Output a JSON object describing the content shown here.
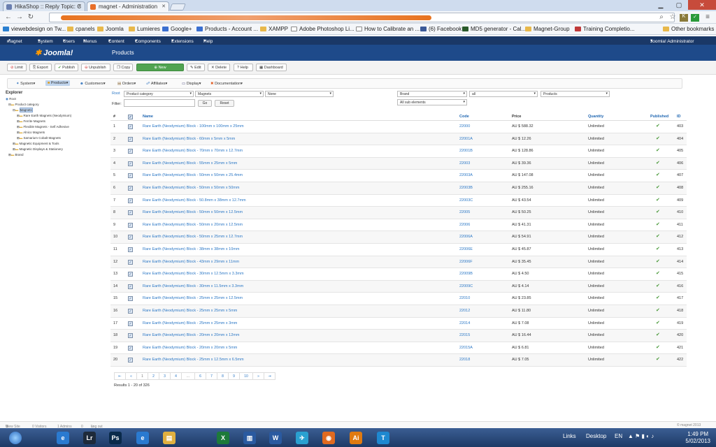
{
  "browser": {
    "tabs": [
      {
        "label": "HikaShop :: Reply Topic: C",
        "color": "#6a7fb0"
      },
      {
        "label": "magnet - Administration",
        "color": "#e86f2a"
      }
    ],
    "bookmarks": [
      "viewebdesign on Tw...",
      "cpanels",
      "Joomla",
      "Lumieres",
      "Google+",
      "Products - Account ...",
      "XAMPP",
      "Adobe Photoshop Li...",
      "How to Calibrate an ...",
      "(6) Facebook",
      "MD5 generator - Cal...",
      "Magnet-Group",
      "Training Completio..."
    ],
    "other_bookmarks": "Other bookmarks"
  },
  "joomla": {
    "site": "magnet",
    "menu": [
      "System",
      "Users",
      "Menus",
      "Content",
      "Components",
      "Extensions",
      "Help"
    ],
    "user": "Joomla! Administrator",
    "logo": "Joomla!",
    "page_title": "Products",
    "toolbar": [
      "Limit",
      "Export",
      "Publish",
      "Unpublish",
      "Copy",
      "New",
      "Edit",
      "Delete",
      "Help",
      "Dashboard"
    ],
    "hika_menu": [
      "System",
      "Products",
      "Customers",
      "Orders",
      "Affiliates",
      "Display",
      "Documentation"
    ],
    "explorer": {
      "title": "Explorer",
      "root": "Root",
      "product_category": "Product category",
      "magnets": "Magnets",
      "children": [
        "Rare Earth Magnets (Neodymium)",
        "Ferrite Magnets",
        "Flexible Magnets - Self Adhesive",
        "Alnico Magnets",
        "Samarium Cobalt Magnets"
      ],
      "siblings": [
        "Magnetic Equipment & Tools",
        "Magnetic Displays & Stationery"
      ],
      "brand": "Brand"
    },
    "filters": {
      "root": "Root",
      "category": "Product category",
      "magnets": "Magnets",
      "none": "None",
      "brand": "Brand",
      "all": "all",
      "products": "Products",
      "sub": "All sub elements",
      "filter_label": "Filter:",
      "go": "Go",
      "reset": "Reset"
    },
    "columns": {
      "num": "#",
      "name": "Name",
      "code": "Code",
      "price": "Price",
      "quantity": "Quantity",
      "published": "Published",
      "id": "ID"
    },
    "rows": [
      {
        "n": "1",
        "name": "Rare Earth (Neodymium) Block - 100mm x 100mm x 25mm",
        "code": "22000",
        "price": "AU $ 588.32",
        "qty": "Unlimited",
        "id": "403"
      },
      {
        "n": "2",
        "name": "Rare Earth (Neodymium) Block - 60mm x 5mm x 5mm",
        "code": "22001A",
        "price": "AU $ 12.26",
        "qty": "Unlimited",
        "id": "404"
      },
      {
        "n": "3",
        "name": "Rare Earth (Neodymium) Block - 70mm x 70mm x 12.7mm",
        "code": "22001B",
        "price": "AU $ 128.86",
        "qty": "Unlimited",
        "id": "405"
      },
      {
        "n": "4",
        "name": "Rare Earth (Neodymium) Block - 55mm x 25mm x 5mm",
        "code": "22003",
        "price": "AU $ 39.36",
        "qty": "Unlimited",
        "id": "406"
      },
      {
        "n": "5",
        "name": "Rare Earth (Neodymium) Block - 50mm x 50mm x 25.4mm",
        "code": "22003A",
        "price": "AU $ 147.08",
        "qty": "Unlimited",
        "id": "407"
      },
      {
        "n": "6",
        "name": "Rare Earth (Neodymium) Block - 50mm x 50mm x 50mm",
        "code": "22003B",
        "price": "AU $ 255.16",
        "qty": "Unlimited",
        "id": "408"
      },
      {
        "n": "7",
        "name": "Rare Earth (Neodymium) Block - 50.8mm x 38mm x 12.7mm",
        "code": "22003C",
        "price": "AU $ 43.54",
        "qty": "Unlimited",
        "id": "409"
      },
      {
        "n": "8",
        "name": "Rare Earth (Neodymium) Block - 50mm x 50mm x 12.5mm",
        "code": "22005",
        "price": "AU $ 50.25",
        "qty": "Unlimited",
        "id": "410"
      },
      {
        "n": "9",
        "name": "Rare Earth (Neodymium) Block - 50mm x 20mm x 12.5mm",
        "code": "22006",
        "price": "AU $ 41.31",
        "qty": "Unlimited",
        "id": "411"
      },
      {
        "n": "10",
        "name": "Rare Earth (Neodymium) Block - 50mm x 25mm x 12.7mm",
        "code": "22006A",
        "price": "AU $ 54.91",
        "qty": "Unlimited",
        "id": "412"
      },
      {
        "n": "11",
        "name": "Rare Earth (Neodymium) Block - 38mm x 38mm x 10mm",
        "code": "22006E",
        "price": "AU $ 45.87",
        "qty": "Unlimited",
        "id": "413"
      },
      {
        "n": "12",
        "name": "Rare Earth (Neodymium) Block - 43mm x 29mm x 11mm",
        "code": "22006F",
        "price": "AU $ 35.45",
        "qty": "Unlimited",
        "id": "414"
      },
      {
        "n": "13",
        "name": "Rare Earth (Neodymium) Block - 30mm x 12.5mm x 3.3mm",
        "code": "22009B",
        "price": "AU $ 4.50",
        "qty": "Unlimited",
        "id": "415"
      },
      {
        "n": "14",
        "name": "Rare Earth (Neodymium) Block - 30mm x 11.5mm x 3.3mm",
        "code": "22009C",
        "price": "AU $ 4.14",
        "qty": "Unlimited",
        "id": "416"
      },
      {
        "n": "15",
        "name": "Rare Earth (Neodymium) Block - 25mm x 25mm x 12.5mm",
        "code": "22010",
        "price": "AU $ 23.85",
        "qty": "Unlimited",
        "id": "417"
      },
      {
        "n": "16",
        "name": "Rare Earth (Neodymium) Block - 25mm x 25mm x 5mm",
        "code": "22012",
        "price": "AU $ 11.80",
        "qty": "Unlimited",
        "id": "418"
      },
      {
        "n": "17",
        "name": "Rare Earth (Neodymium) Block - 25mm x 25mm x 3mm",
        "code": "22014",
        "price": "AU $ 7.08",
        "qty": "Unlimited",
        "id": "419"
      },
      {
        "n": "18",
        "name": "Rare Earth (Neodymium) Block - 20mm x 20mm x 12mm",
        "code": "22015",
        "price": "AU $ 16.44",
        "qty": "Unlimited",
        "id": "420"
      },
      {
        "n": "19",
        "name": "Rare Earth (Neodymium) Block - 20mm x 20mm x 5mm",
        "code": "22015A",
        "price": "AU $ 6.81",
        "qty": "Unlimited",
        "id": "421"
      },
      {
        "n": "20",
        "name": "Rare Earth (Neodymium) Block - 25mm x 12.5mm x 6.5mm",
        "code": "22018",
        "price": "AU $ 7.05",
        "qty": "Unlimited",
        "id": "422"
      }
    ],
    "pager": [
      "⇤",
      "«",
      "1",
      "2",
      "3",
      "4",
      "...",
      "6",
      "7",
      "8",
      "9",
      "10",
      "»",
      "⇥"
    ],
    "results": "Results 1 - 20 of 326",
    "status": {
      "view_site": "View Site",
      "visitors": "0 Visitors",
      "admins": "1 Admins",
      "messages": "0",
      "logout": "Log out",
      "copyright": "© magnet 2013"
    }
  },
  "taskbar": {
    "apps": [
      "IE",
      "Lr",
      "Ps",
      "IE",
      "Files",
      "Excel",
      "Notes",
      "Word",
      "Twitter",
      "Firefox",
      "Ai",
      "Tel"
    ],
    "links": "Links",
    "desktop": "Desktop",
    "lang": "EN",
    "time": "1:49 PM",
    "date": "5/02/2013"
  }
}
